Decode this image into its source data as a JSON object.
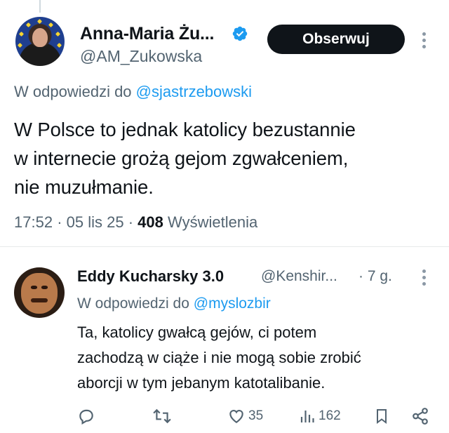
{
  "main_tweet": {
    "display_name": "Anna-Maria Żu...",
    "handle": "@AM_Zukowska",
    "follow_label": "Obserwuj",
    "reply_prefix": "W odpowiedzi do",
    "reply_mention": "@sjastrzebowski",
    "text_lines": [
      "W Polsce to jednak katolicy bezustannie",
      "w internecie grożą gejom zgwałceniem,",
      "nie muzułmanie."
    ],
    "time": "17:52",
    "date": "05 lis 25",
    "views_count": "408",
    "views_label": "Wyświetlenia",
    "separator": "·"
  },
  "reply_tweet": {
    "display_name": "Eddy Kucharsky 3.0",
    "handle": "@Kenshir...",
    "time": "· 7 g.",
    "reply_prefix": "W odpowiedzi do",
    "reply_mention": "@myslozbir",
    "text_lines": [
      "Ta, katolicy gwałcą gejów, ci potem",
      "zachodzą w ciąże i nie mogą sobie zrobić",
      "aborcji w tym jebanym katotalibanie."
    ],
    "actions": {
      "likes": "35",
      "views": "162"
    }
  },
  "icons": {
    "verified": "verified-badge-icon",
    "more": "more-vertical-icon",
    "reply": "reply-icon",
    "retweet": "retweet-icon",
    "like": "heart-icon",
    "views": "analytics-icon",
    "bookmark": "bookmark-icon",
    "share": "share-icon"
  },
  "colors": {
    "accent": "#1d9bf0",
    "text": "#0f1419",
    "secondary": "#536471",
    "follow_bg": "#0f1419"
  }
}
